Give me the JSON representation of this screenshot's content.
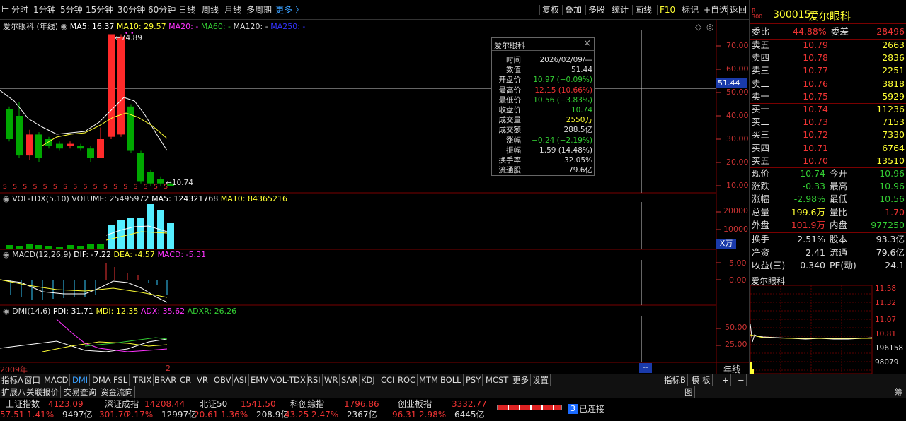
{
  "toolbar": {
    "periods": [
      "分时",
      "1分钟",
      "5分钟",
      "15分钟",
      "30分钟",
      "60分钟",
      "日线",
      "周线",
      "月线",
      "多周期",
      "更多 〉"
    ],
    "tools": [
      "复权",
      "叠加",
      "多股",
      "统计",
      "画线",
      "F10",
      "标记",
      "+自选",
      "返回"
    ]
  },
  "stock": {
    "code": "300015",
    "name": "爱尔眼科",
    "market_top": "R",
    "market_bottom": "300"
  },
  "main_panel": {
    "title": "爱尔眼科 (年线)",
    "ma5_label": "MA5: 16.37",
    "ma10_label": "MA10: 29.57",
    "ma20_label": "MA20: -",
    "ma60_label": "MA60: -",
    "ma120_label": "MA120: -",
    "ma250_label": "MA250: -",
    "axis": [
      "70.00",
      "60.00",
      "50.00",
      "40.00",
      "30.00",
      "20.00",
      "10.00"
    ],
    "high_marker": "74.89",
    "low_marker": "10.74",
    "cursor_price": "51.44"
  },
  "vol_panel": {
    "title": "VOL-TDX(5,10)",
    "volume_label": "VOLUME: 25495972",
    "ma5_label": "MA5: 124321768",
    "ma10_label": "MA10: 84365216",
    "axis": [
      "20000",
      "10000"
    ],
    "unit": "X万"
  },
  "macd_panel": {
    "title": "MACD(12,26,9)",
    "dif_label": "DIF: -7.22",
    "dea_label": "DEA: -4.57",
    "macd_label": "MACD: -5.31",
    "axis": [
      "5.00",
      "0.00"
    ]
  },
  "dmi_panel": {
    "title": "DMI(14,6)",
    "pdi_label": "PDI: 31.71",
    "mdi_label": "MDI: 12.35",
    "adx_label": "ADX: 35.62",
    "adxr_label": "ADXR: 26.26",
    "axis": [
      "50.00",
      "25.00"
    ]
  },
  "xaxis": {
    "start": "2009年",
    "mid": "2",
    "cursor": "--",
    "period": "年线"
  },
  "popup": {
    "title": "爱尔眼科",
    "rows": [
      {
        "k": "时间",
        "v": "2026/02/09/—"
      },
      {
        "k": "数值",
        "v": "51.44"
      },
      {
        "k": "开盘价",
        "v": "10.97 (−0.09%)"
      },
      {
        "k": "最高价",
        "v": "12.15 (10.66%)"
      },
      {
        "k": "最低价",
        "v": "10.56 (−3.83%)"
      },
      {
        "k": "收盘价",
        "v": "10.74"
      },
      {
        "k": "成交量",
        "v": "2550万"
      },
      {
        "k": "成交额",
        "v": "288.5亿"
      },
      {
        "k": "涨幅",
        "v": "−0.24 (−2.19%)"
      },
      {
        "k": "振幅",
        "v": "1.59 (14.48%)"
      },
      {
        "k": "换手率",
        "v": "32.05%"
      },
      {
        "k": "流通股",
        "v": "79.6亿"
      }
    ],
    "colors": [
      "#ddd",
      "#ddd",
      "#3c3",
      "#e33",
      "#3c3",
      "#3c3",
      "#ff3",
      "#ddd",
      "#3c3",
      "#ddd",
      "#ddd",
      "#ddd"
    ]
  },
  "orderbook": {
    "ratio_label": "委比",
    "ratio": "44.88%",
    "diff_label": "委差",
    "diff": "28496",
    "sells": [
      {
        "l": "卖五",
        "p": "10.79",
        "q": "2663"
      },
      {
        "l": "卖四",
        "p": "10.78",
        "q": "2836"
      },
      {
        "l": "卖三",
        "p": "10.77",
        "q": "2251"
      },
      {
        "l": "卖二",
        "p": "10.76",
        "q": "3818"
      },
      {
        "l": "卖一",
        "p": "10.75",
        "q": "5929"
      }
    ],
    "buys": [
      {
        "l": "买一",
        "p": "10.74",
        "q": "11236"
      },
      {
        "l": "买二",
        "p": "10.73",
        "q": "7153"
      },
      {
        "l": "买三",
        "p": "10.72",
        "q": "7330"
      },
      {
        "l": "买四",
        "p": "10.71",
        "q": "6764"
      },
      {
        "l": "买五",
        "p": "10.70",
        "q": "13510"
      }
    ]
  },
  "stats": [
    {
      "l1": "现价",
      "v1": "10.74",
      "c1": "#3c3",
      "l2": "今开",
      "v2": "10.96",
      "c2": "#3c3"
    },
    {
      "l1": "涨跌",
      "v1": "-0.33",
      "c1": "#3c3",
      "l2": "最高",
      "v2": "10.96",
      "c2": "#3c3"
    },
    {
      "l1": "涨幅",
      "v1": "-2.98%",
      "c1": "#3c3",
      "l2": "最低",
      "v2": "10.56",
      "c2": "#3c3"
    },
    {
      "l1": "总量",
      "v1": "199.6万",
      "c1": "#ff3",
      "l2": "量比",
      "v2": "1.70",
      "c2": "#e33"
    },
    {
      "l1": "外盘",
      "v1": "101.9万",
      "c1": "#e33",
      "l2": "内盘",
      "v2": "977250",
      "c2": "#3c3"
    },
    {
      "l1": "换手",
      "v1": "2.51%",
      "c1": "#ddd",
      "l2": "股本",
      "v2": "93.3亿",
      "c2": "#ddd"
    },
    {
      "l1": "净资",
      "v1": "2.41",
      "c1": "#ddd",
      "l2": "流通",
      "v2": "79.6亿",
      "c2": "#ddd"
    },
    {
      "l1": "收益(三)",
      "v1": "0.340",
      "c1": "#ddd",
      "l2": "PE(动)",
      "v2": "24.1",
      "c2": "#ddd"
    }
  ],
  "mini": {
    "title": "爱尔眼科",
    "axis": [
      "11.58",
      "11.32",
      "11.07",
      "10.81",
      "196158",
      "98079"
    ]
  },
  "bottom_tabs": [
    "指标A",
    "窗口",
    "MACD",
    "DMI",
    "DMA",
    "FSL",
    "TRIX",
    "BRAR",
    "CR",
    "VR",
    "OBV",
    "ASI",
    "EMV",
    "VOL-TDX",
    "RSI",
    "WR",
    "SAR",
    "KDJ",
    "CCI",
    "ROC",
    "MTM",
    "BOLL",
    "PSY",
    "MCST",
    "更多",
    "设置"
  ],
  "bottom_right_tabs": [
    "指标B",
    "模 板",
    "+",
    "−"
  ],
  "bottom_row2": [
    "扩展八",
    "关联报价",
    "交易查询",
    "资金流向"
  ],
  "bottom_row2_right": "图",
  "bottom_row2_far": "筹",
  "ticker": {
    "items": [
      {
        "name": "上证指数",
        "value": "4123.09",
        "chg": "57.51",
        "pct": "1.41%",
        "amt": "9497亿"
      },
      {
        "name": "深证成指",
        "value": "14208.44",
        "chg": "301.70",
        "pct": "2.17%",
        "amt": "12997亿"
      },
      {
        "name": "北证50",
        "value": "1541.50",
        "chg": "20.61",
        "pct": "1.36%",
        "amt": "208.9亿"
      },
      {
        "name": "科创综指",
        "value": "1796.86",
        "chg": "43.25",
        "pct": "2.47%",
        "amt": "2367亿"
      },
      {
        "name": "创业板指",
        "value": "3332.77",
        "chg": "96.31",
        "pct": "2.98%",
        "amt": "6445亿"
      }
    ],
    "conn_num": "3",
    "conn_label": "已连接"
  },
  "colors": {
    "up": "#ff2a2a",
    "down": "#00a800",
    "ma5": "#ffffff",
    "ma10": "#ffff33",
    "vol_up": "#55eeff",
    "accent_blue": "#3aa0ff"
  }
}
